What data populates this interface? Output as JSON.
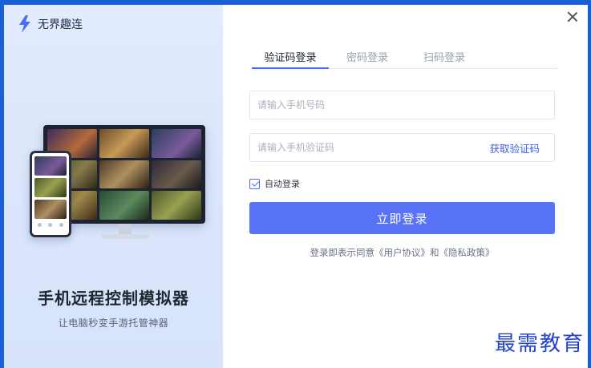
{
  "brand": {
    "name": "无界趣连",
    "logo_icon": "lightning-bolt-icon",
    "accent": "#4b6cf7"
  },
  "promo": {
    "title": "手机远程控制模拟器",
    "subtitle": "让电脑秒变手游托管神器"
  },
  "window": {
    "close_icon": "close-icon"
  },
  "tabs": [
    {
      "label": "验证码登录",
      "active": true
    },
    {
      "label": "密码登录",
      "active": false
    },
    {
      "label": "扫码登录",
      "active": false
    }
  ],
  "form": {
    "phone_placeholder": "请输入手机号码",
    "code_placeholder": "请输入手机验证码",
    "get_code_label": "获取验证码",
    "auto_login_label": "自动登录",
    "auto_login_checked": true,
    "submit_label": "立即登录"
  },
  "agreement": {
    "prefix": "登录即表示同意",
    "user_agreement": "《用户协议》",
    "conjunction": "和",
    "privacy_policy": "《隐私政策》"
  },
  "watermark": "最需教育",
  "colors": {
    "primary_button": "#5873f5",
    "link": "#3f5fe8",
    "left_panel_bg": "#dbe6fb"
  }
}
